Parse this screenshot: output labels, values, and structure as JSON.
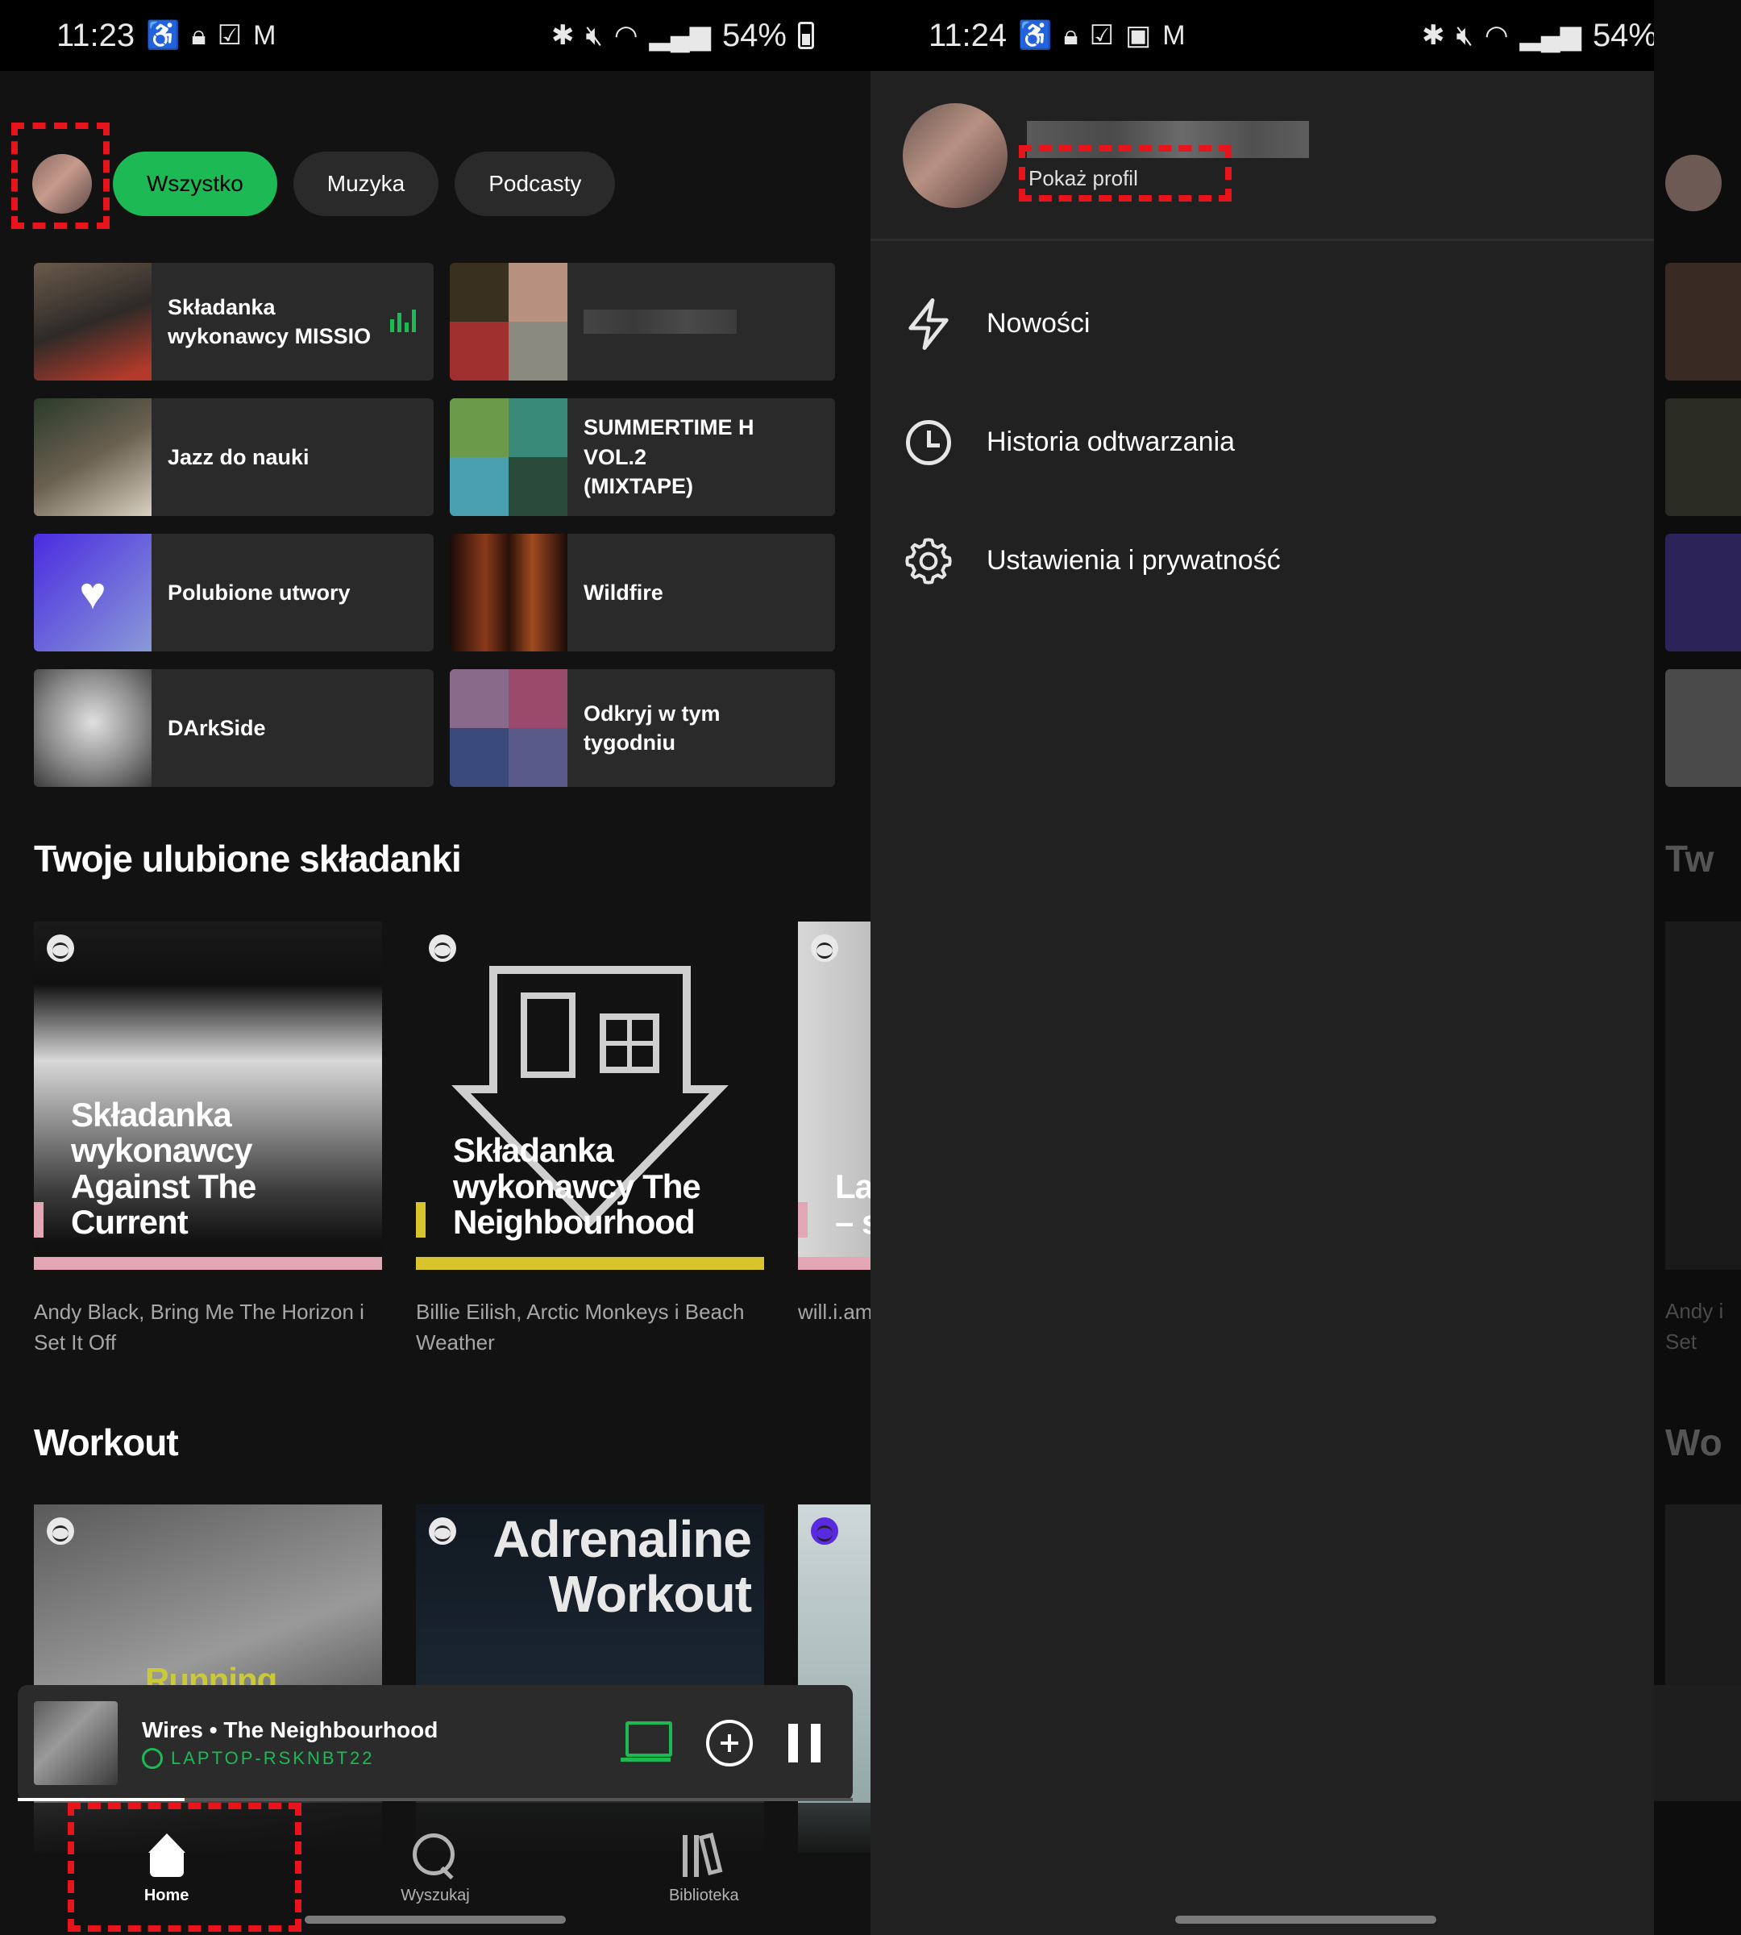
{
  "left": {
    "status": {
      "time": "11:23",
      "battery": "54%"
    },
    "chips": [
      "Wszystko",
      "Muzyka",
      "Podcasty"
    ],
    "shortcuts": [
      {
        "label": "Składanka wykonawcy MISSIO",
        "playing": true
      },
      {
        "label": ""
      },
      {
        "label": "Jazz do nauki"
      },
      {
        "label": "SUMMERTIME H VOL.2 (MIXTAPE)"
      },
      {
        "label": "Polubione utwory"
      },
      {
        "label": "Wildfire"
      },
      {
        "label": "DArkSide"
      },
      {
        "label": "Odkryj w tym tygodniu"
      }
    ],
    "section1": {
      "title": "Twoje ulubione składanki",
      "cards": [
        {
          "cover_title": "Składanka wykonawcy Against The Current",
          "subtitle": "Andy Black, Bring Me The Horizon i Set It Off",
          "accent": "#e3a6b4"
        },
        {
          "cover_title": "Składanka wykonawcy The Neighbourhood",
          "subtitle": "Billie Eilish, Arctic Monkeys i Beach Weather",
          "accent": "#d8c42c"
        },
        {
          "cover_title": "La – s",
          "subtitle": "will.i.am Neighb",
          "accent": "#e3a6b4"
        }
      ]
    },
    "section2": {
      "title": "Workout",
      "cards": [
        {
          "cover_title": "Running"
        },
        {
          "cover_title": "Adrenaline Workout"
        },
        {
          "cover_title": ""
        }
      ]
    },
    "player": {
      "title": "Wires • The Neighbourhood",
      "device": "LAPTOP-RSKNBT22",
      "progress": 0.2
    },
    "nav": [
      "Home",
      "Wyszukaj",
      "Biblioteka"
    ]
  },
  "right": {
    "status": {
      "time": "11:24",
      "battery": "54%"
    },
    "profile": {
      "show_profile": "Pokaż profil"
    },
    "menu": [
      {
        "label": "Nowości",
        "icon": "lightning-icon"
      },
      {
        "label": "Historia odtwarzania",
        "icon": "clock-icon"
      },
      {
        "label": "Ustawienia i prywatność",
        "icon": "gear-icon"
      }
    ],
    "peek": {
      "section1_title": "Tw",
      "section2_title": "Wo",
      "card_sub": "Andy i Set"
    }
  },
  "colors": {
    "accent": "#1db954",
    "highlight": "#e8141b",
    "background": "#121212",
    "drawer": "#212121"
  }
}
